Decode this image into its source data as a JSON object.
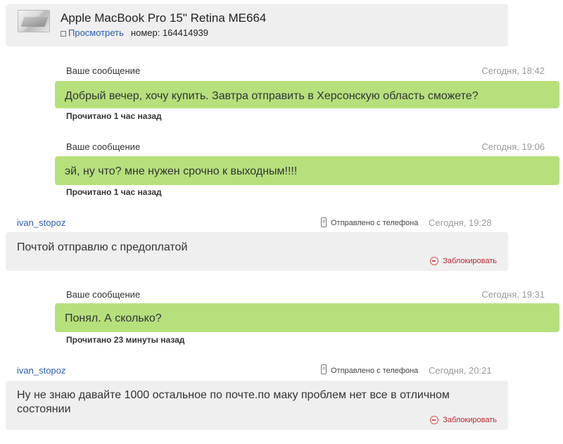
{
  "product": {
    "title": "Apple MacBook Pro 15\" Retina ME664",
    "view_link": "Просмотреть",
    "number_label": "номер: 164414939"
  },
  "messages": [
    {
      "own": true,
      "label": "Ваше сообщение",
      "time": "Сегодня, 18:42",
      "text": "Добрый вечер, хочу купить. Завтра отправить в Херсонскую область сможете?",
      "status": "Прочитано 1 час назад"
    },
    {
      "own": true,
      "label": "Ваше сообщение",
      "time": "Сегодня, 19:06",
      "text": "эй, ну что? мне нужен срочно к выходным!!!!",
      "status": "Прочитано 1 час назад"
    },
    {
      "own": false,
      "user": "ivan_stopoz",
      "phone_label": "Отправлено с телефона",
      "time": "Сегодня, 19:28",
      "text": "Почтой отправлю с предоплатой",
      "block_label": "Заблокировать"
    },
    {
      "own": true,
      "label": "Ваше сообщение",
      "time": "Сегодня, 19:31",
      "text": "Понял. А сколько?",
      "status": "Прочитано 23 минуты назад"
    },
    {
      "own": false,
      "user": "ivan_stopoz",
      "phone_label": "Отправлено с телефона",
      "time": "Сегодня, 20:21",
      "text": "Ну не знаю давайте 1000 остальное по почте.по маку проблем нет все в отличном состоянии",
      "block_label": "Заблокировать"
    }
  ],
  "colors": {
    "own_bubble": "#b6e07c",
    "incoming_bubble": "#efefef",
    "link": "#2a5db0",
    "block": "#b8282c"
  }
}
